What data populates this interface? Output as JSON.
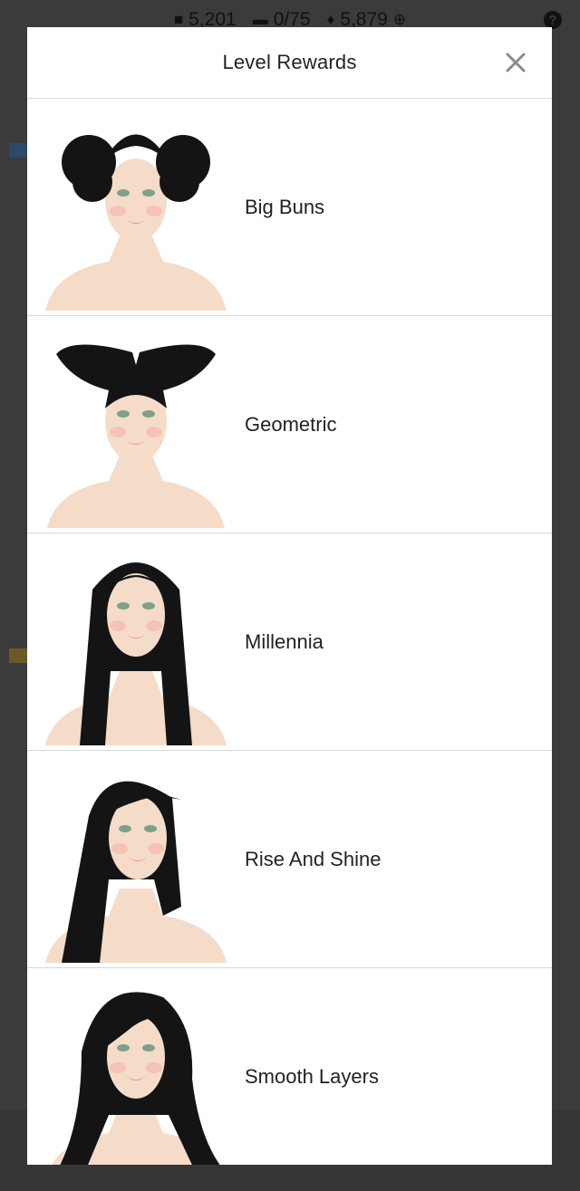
{
  "status_bar": {
    "cash": "5,201",
    "tickets": "0/75",
    "diamonds": "5,879"
  },
  "modal": {
    "title": "Level Rewards",
    "rewards": [
      {
        "name": "Big Buns",
        "style": "big-buns"
      },
      {
        "name": "Geometric",
        "style": "geometric"
      },
      {
        "name": "Millennia",
        "style": "millennia"
      },
      {
        "name": "Rise And Shine",
        "style": "rise-and-shine"
      },
      {
        "name": "Smooth Layers",
        "style": "smooth-layers"
      }
    ]
  },
  "colors": {
    "hair": "#141414",
    "skin": "#f4dcc9",
    "blush": "#f3b3a8",
    "lips": "#e58f88",
    "eyes": "#7fa08a",
    "overlay": "#3b3b3b"
  }
}
